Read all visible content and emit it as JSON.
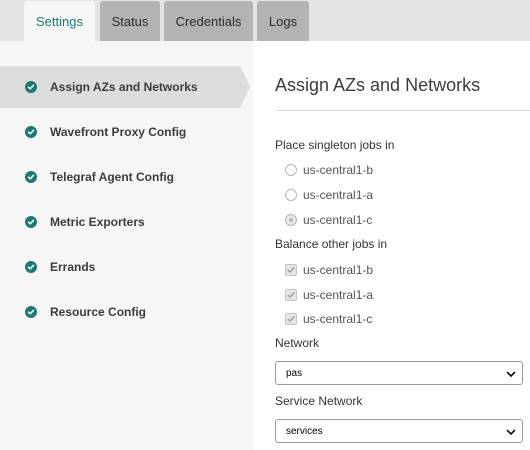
{
  "tabs": [
    {
      "label": "Settings",
      "active": true
    },
    {
      "label": "Status",
      "active": false
    },
    {
      "label": "Credentials",
      "active": false
    },
    {
      "label": "Logs",
      "active": false
    }
  ],
  "sidebar": {
    "items": [
      {
        "label": "Assign AZs and Networks",
        "status_icon": "check-circle-icon",
        "active": true
      },
      {
        "label": "Wavefront Proxy Config",
        "status_icon": "check-circle-icon",
        "active": false
      },
      {
        "label": "Telegraf Agent Config",
        "status_icon": "check-circle-icon",
        "active": false
      },
      {
        "label": "Metric Exporters",
        "status_icon": "check-circle-icon",
        "active": false
      },
      {
        "label": "Errands",
        "status_icon": "check-circle-icon",
        "active": false
      },
      {
        "label": "Resource Config",
        "status_icon": "check-circle-icon",
        "active": false
      }
    ]
  },
  "main": {
    "title": "Assign AZs and Networks",
    "singleton": {
      "label": "Place singleton jobs in",
      "options": [
        "us-central1-b",
        "us-central1-a",
        "us-central1-c"
      ],
      "selected": "us-central1-c"
    },
    "balance": {
      "label": "Balance other jobs in",
      "options": [
        "us-central1-b",
        "us-central1-a",
        "us-central1-c"
      ],
      "checked": [
        true,
        true,
        true
      ]
    },
    "network": {
      "label": "Network",
      "value": "pas"
    },
    "service_network": {
      "label": "Service Network",
      "value": "services"
    }
  },
  "colors": {
    "accent": "#1b7a76",
    "tabbar_bg": "#e4e4e4",
    "tab_inactive": "#b3b3b3",
    "sidebar_bg": "#f6f6f6",
    "sidebar_active": "#dcdcdc"
  }
}
